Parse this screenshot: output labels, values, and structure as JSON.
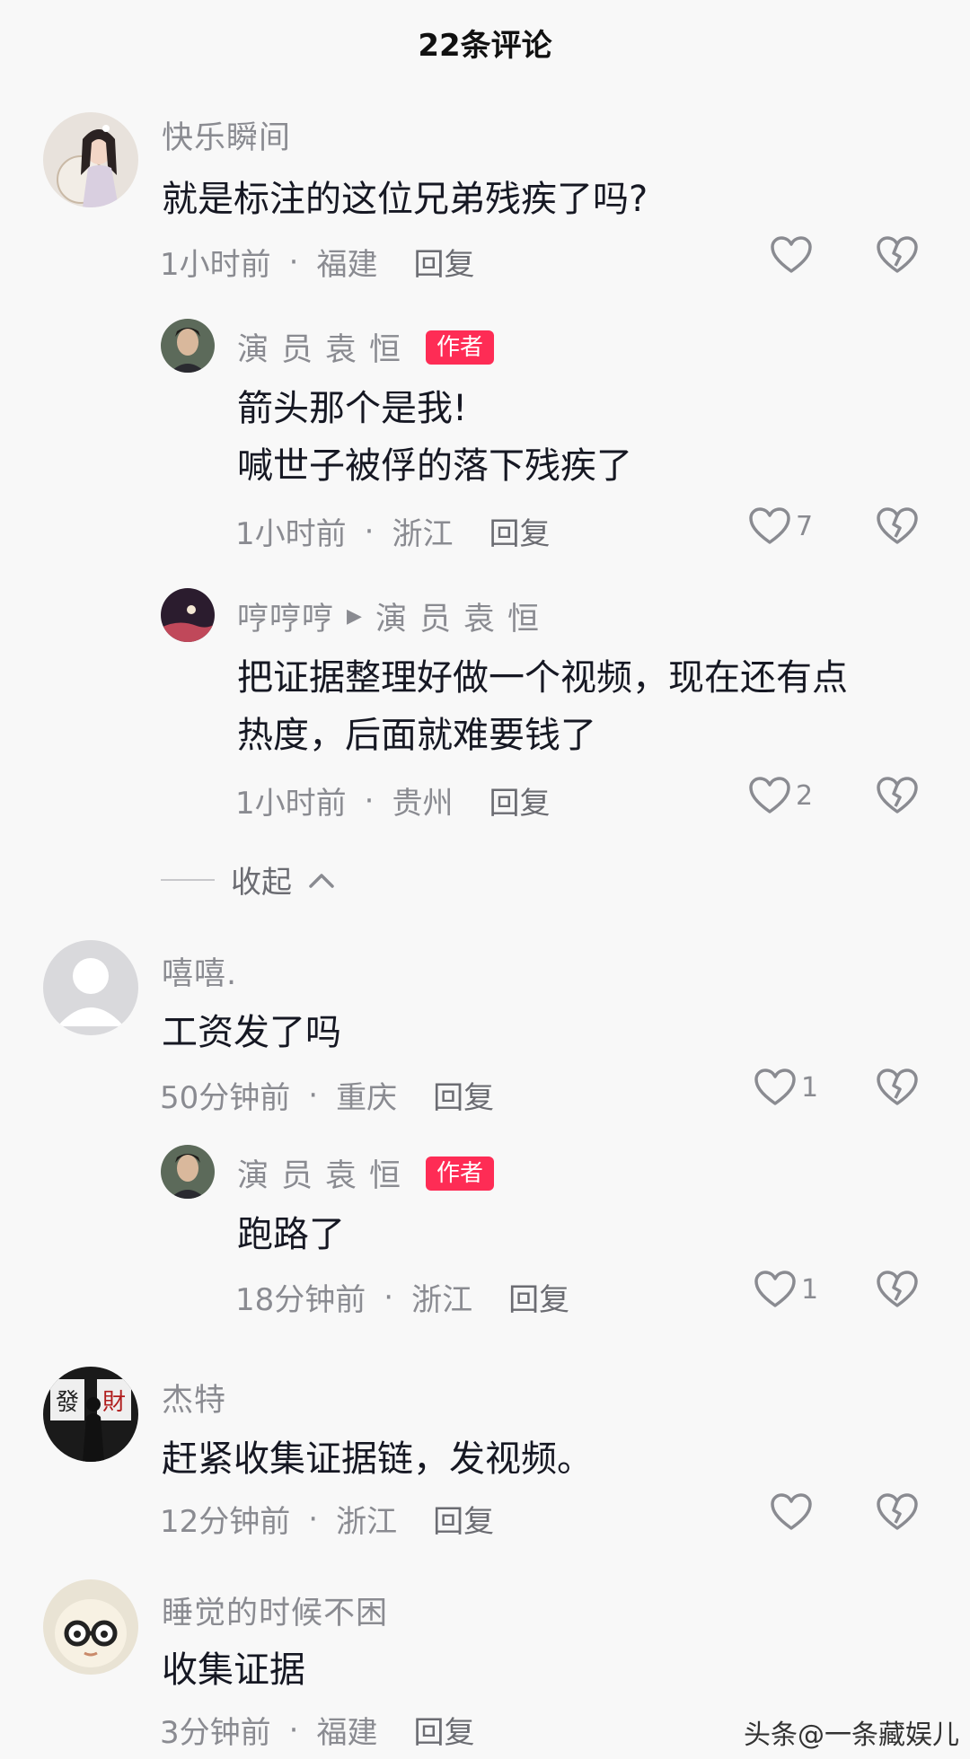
{
  "header": {
    "title": "22条评论"
  },
  "comments": [
    {
      "user": "快乐瞬间",
      "text_lines": [
        "就是标注的这位兄弟残疾了吗?"
      ],
      "time": "1小时前",
      "location": "福建",
      "reply": "回复",
      "likes": ""
    },
    {
      "user": "演员袁恒",
      "badge": "作者",
      "text_lines": [
        "箭头那个是我!",
        "喊世子被俘的落下残疾了"
      ],
      "time": "1小时前",
      "location": "浙江",
      "reply": "回复",
      "likes": "7"
    },
    {
      "user": "哼哼哼",
      "reply_to": "演员袁恒",
      "text_lines": [
        "把证据整理好做一个视频，现在还有点",
        "热度，后面就难要钱了"
      ],
      "time": "1小时前",
      "location": "贵州",
      "reply": "回复",
      "likes": "2"
    },
    {
      "user": "嘻嘻.",
      "text_lines": [
        "工资发了吗"
      ],
      "time": "50分钟前",
      "location": "重庆",
      "reply": "回复",
      "likes": "1"
    },
    {
      "user": "演员袁恒",
      "badge": "作者",
      "text_lines": [
        "跑路了"
      ],
      "time": "18分钟前",
      "location": "浙江",
      "reply": "回复",
      "likes": "1"
    },
    {
      "user": "杰特",
      "text_lines": [
        "赶紧收集证据链，发视频。"
      ],
      "time": "12分钟前",
      "location": "浙江",
      "reply": "回复",
      "likes": ""
    },
    {
      "user": "睡觉的时候不困",
      "text_lines": [
        "收集证据"
      ],
      "time": "3分钟前",
      "location": "福建",
      "reply": "回复",
      "likes": ""
    }
  ],
  "collapse": {
    "label": "收起"
  },
  "avatar_glyphs": {
    "jiete": [
      "發",
      "財"
    ]
  },
  "watermark": "头条@一条藏娱儿",
  "colors": {
    "badge": "#fe2c55",
    "muted": "#8a8b91",
    "text": "#161823"
  },
  "icons": [
    "heart-icon",
    "broken-heart-icon",
    "chevron-up-icon",
    "play-triangle-icon"
  ]
}
